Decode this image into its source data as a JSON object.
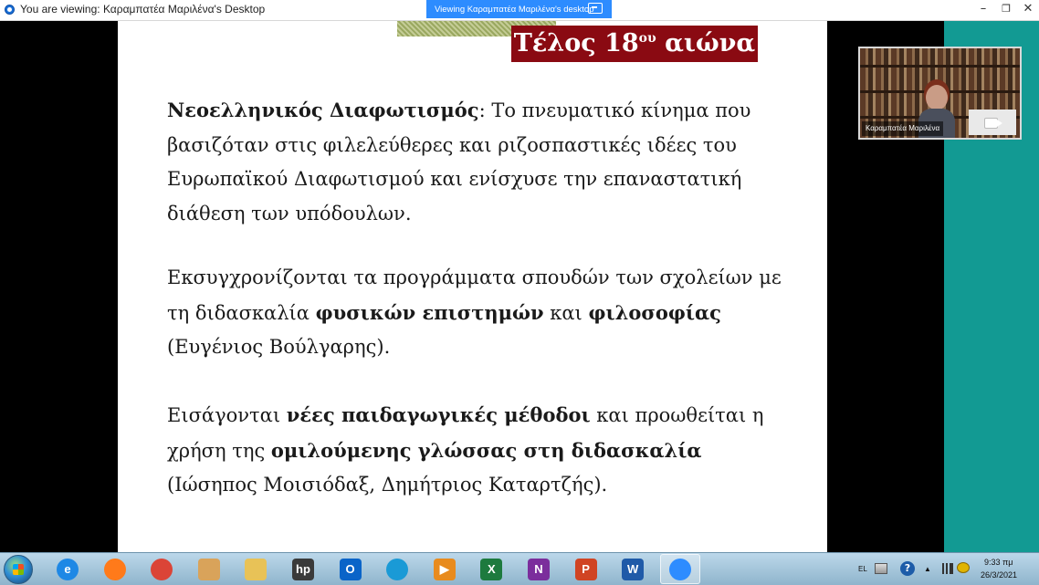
{
  "window": {
    "title": "You are viewing: Καραμπατέα Μαριλένα's Desktop",
    "viewing_badge": "Viewing Καραμπατέα Μαριλένα's desktop",
    "controls": {
      "minimize": "–",
      "restore": "❐",
      "close": "✕"
    }
  },
  "slide": {
    "title_main": "Τέλος 18",
    "title_sup": "ου",
    "title_end": " αιώνα",
    "p1": {
      "term": "Νεοελληνικός Διαφωτισμός",
      "rest": ": Το πνευματικό κίνημα που βασιζόταν στις φιλελεύθερες και ριζοσπαστικές ιδέες του Ευρωπαϊκού Διαφωτισμού και ενίσχυσε την επαναστατική διάθεση των υπόδουλων."
    },
    "p2": {
      "part1": "Εκσυγχρονίζονται τα προγράμματα σπουδών των σχολείων με τη διδασκαλία ",
      "bold1": "φυσικών επιστημών",
      "part2": " και ",
      "bold2": "φιλοσοφίας",
      "part3": " (Ευγένιος Βούλγαρης)."
    },
    "p3": {
      "part1": "Εισάγονται ",
      "bold1": "νέες παιδαγωγικές μέθοδοι",
      "part2": " και προωθείται η χρήση της ",
      "bold2": "ομιλούμενης γλώσσας στη διδασκαλία",
      "part3": " (Ιώσηπος Μοισιόδαξ, Δημήτριος Καταρτζής)."
    }
  },
  "video": {
    "participant_name": "Καραμπατέα Μαριλένα"
  },
  "taskbar": {
    "apps": [
      {
        "name": "internet-explorer",
        "label": "e",
        "color": "#1e88e5"
      },
      {
        "name": "firefox",
        "label": "",
        "color": "#ff7a1a"
      },
      {
        "name": "chrome",
        "label": "",
        "color": "#db4437"
      },
      {
        "name": "paint",
        "label": "",
        "color": "#d9a35a"
      },
      {
        "name": "file-explorer",
        "label": "",
        "color": "#e8c257"
      },
      {
        "name": "hp",
        "label": "hp",
        "color": "#3a3a3a"
      },
      {
        "name": "outlook",
        "label": "O",
        "color": "#0a64c8"
      },
      {
        "name": "edge",
        "label": "",
        "color": "#1a9ad6"
      },
      {
        "name": "media-player",
        "label": "▶",
        "color": "#e88b1e"
      },
      {
        "name": "excel",
        "label": "X",
        "color": "#1d7a3e"
      },
      {
        "name": "onenote",
        "label": "N",
        "color": "#7b2e9c"
      },
      {
        "name": "powerpoint",
        "label": "P",
        "color": "#d04423"
      },
      {
        "name": "word",
        "label": "W",
        "color": "#1f5aa8"
      },
      {
        "name": "zoom",
        "label": "",
        "color": "#2d8cff"
      }
    ],
    "language": "EL",
    "time": "9:33 πμ",
    "date": "26/3/2021"
  }
}
